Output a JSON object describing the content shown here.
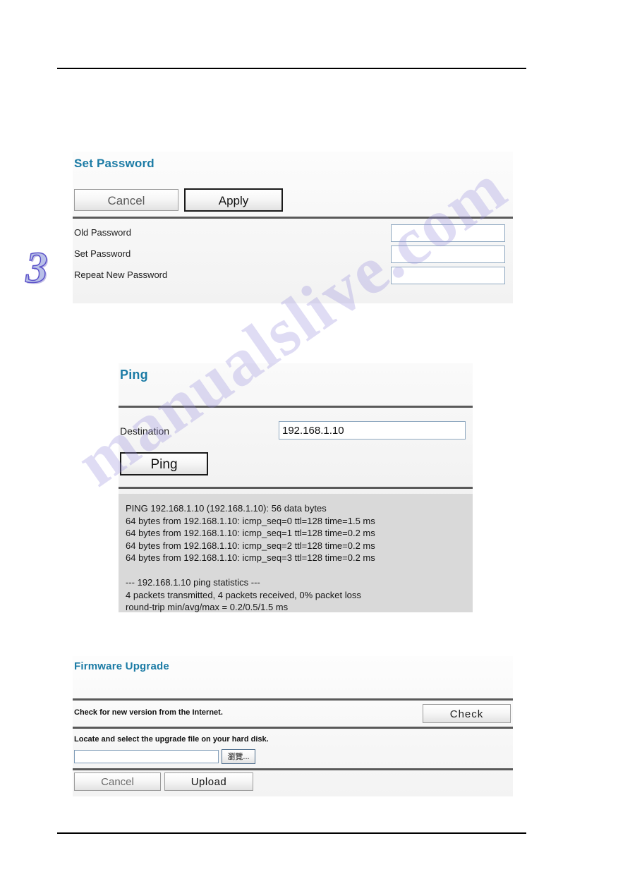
{
  "page": {
    "chapter_number": "3",
    "watermark_text": "manualslive.com"
  },
  "set_password": {
    "title": "Set Password",
    "cancel_label": "Cancel",
    "apply_label": "Apply",
    "fields": [
      {
        "label": "Old Password",
        "value": "",
        "placeholder": ""
      },
      {
        "label": "Set Password",
        "value": "",
        "placeholder": ""
      },
      {
        "label": "Repeat New Password",
        "value": "",
        "placeholder": ""
      }
    ],
    "heading_color": "#1b7ba5"
  },
  "ping": {
    "title": "Ping",
    "destination_label": "Destination",
    "destination_value": "192.168.1.10",
    "destination_placeholder": "",
    "ping_button_label": "Ping",
    "output": "PING 192.168.1.10 (192.168.1.10): 56 data bytes\n64 bytes from 192.168.1.10: icmp_seq=0 ttl=128 time=1.5 ms\n64 bytes from 192.168.1.10: icmp_seq=1 ttl=128 time=0.2 ms\n64 bytes from 192.168.1.10: icmp_seq=2 ttl=128 time=0.2 ms\n64 bytes from 192.168.1.10: icmp_seq=3 ttl=128 time=0.2 ms\n\n--- 192.168.1.10 ping statistics ---\n4 packets transmitted, 4 packets received, 0% packet loss\nround-trip min/avg/max = 0.2/0.5/1.5 ms",
    "heading_color": "#1b7ba5"
  },
  "firmware_upgrade": {
    "title": "Firmware Upgrade",
    "check_text": "Check for new version from the Internet.",
    "check_button_label": "Check",
    "locate_text": "Locate and select the upgrade file on your hard disk.",
    "file_value": "",
    "file_placeholder": "",
    "browse_button_label": "瀏覽...",
    "cancel_label": "Cancel",
    "upload_label": "Upload",
    "heading_color": "#1b7ba5"
  }
}
